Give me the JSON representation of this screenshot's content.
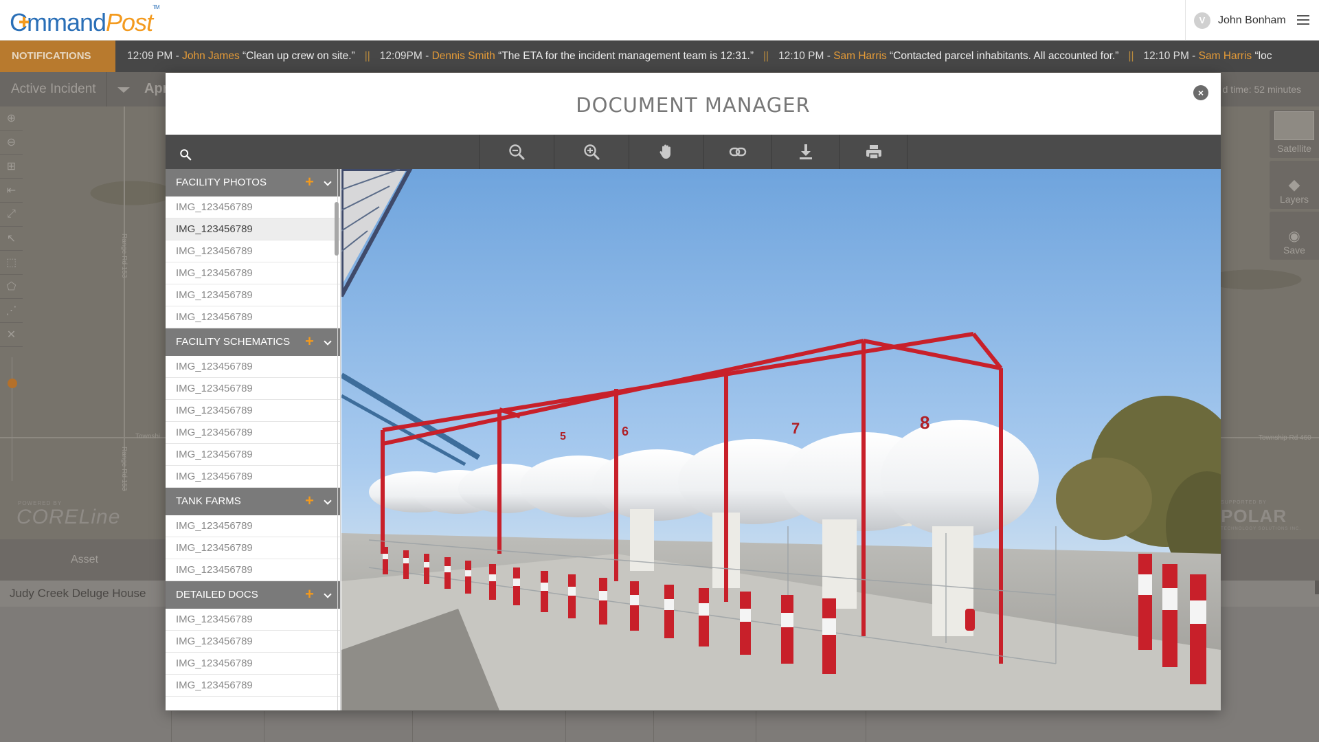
{
  "header": {
    "logo_cmd": "C",
    "logo_cmd_rest": "mmand",
    "logo_post": "Post",
    "logo_tm": "TM",
    "user_initial": "V",
    "user_name": "John Bonham"
  },
  "notifications": {
    "label": "NOTIFICATIONS",
    "items": [
      {
        "time": "12:09 PM -",
        "name": "John James",
        "msg": "“Clean up crew on site.”"
      },
      {
        "time": "12:09PM -",
        "name": "Dennis Smith",
        "msg": "“The ETA for the incident management team is 12:31.”"
      },
      {
        "time": "12:10 PM -",
        "name": "Sam Harris",
        "msg": "“Contacted parcel inhabitants. All accounted for.”"
      },
      {
        "time": "12:10 PM -",
        "name": "Sam Harris",
        "msg": "“loc"
      }
    ],
    "separator": "||"
  },
  "incident": {
    "label": "Active Incident",
    "name": "Apr",
    "elapsed": "d time: 52 minutes"
  },
  "map": {
    "road_labels": [
      "Range Rd 153",
      "Range Rd 153",
      "Townshi",
      "Township Rd 460"
    ],
    "right_panel": [
      "Satellite",
      "Layers",
      "Save"
    ],
    "powered_by": "POWERED BY",
    "coreline": "CORELine",
    "supported_by": "SUPPORTED BY",
    "polar": "POLAR",
    "polar_sub": "TECHNOLOGY SOLUTIONS INC."
  },
  "table": {
    "header_asset": "Asset",
    "row_asset": "Judy Creek Deluge House"
  },
  "modal": {
    "title": "DOCUMENT MANAGER",
    "close_label": "×",
    "tools": [
      "zoom-out-icon",
      "zoom-in-icon",
      "pan-hand-icon",
      "link-icon",
      "download-icon",
      "print-icon"
    ],
    "sections": [
      {
        "title": "FACILITY PHOTOS",
        "files": [
          "IMG_123456789",
          "IMG_123456789",
          "IMG_123456789",
          "IMG_123456789",
          "IMG_123456789",
          "IMG_123456789"
        ],
        "selected_index": 1
      },
      {
        "title": "FACILITY SCHEMATICS",
        "files": [
          "IMG_123456789",
          "IMG_123456789",
          "IMG_123456789",
          "IMG_123456789",
          "IMG_123456789",
          "IMG_123456789"
        ]
      },
      {
        "title": "TANK FARMS",
        "files": [
          "IMG_123456789",
          "IMG_123456789",
          "IMG_123456789"
        ]
      },
      {
        "title": "DETAILED DOCS",
        "files": [
          "IMG_123456789",
          "IMG_123456789",
          "IMG_123456789",
          "IMG_123456789"
        ]
      }
    ],
    "tank_numbers": [
      "5",
      "6",
      "7",
      "8"
    ],
    "colors": {
      "accent_orange": "#f39a1e",
      "brand_blue": "#2a6fb7",
      "section_header": "#7a7a7a",
      "toolbar": "#4b4b4b",
      "tank_red": "#c8202a"
    }
  }
}
